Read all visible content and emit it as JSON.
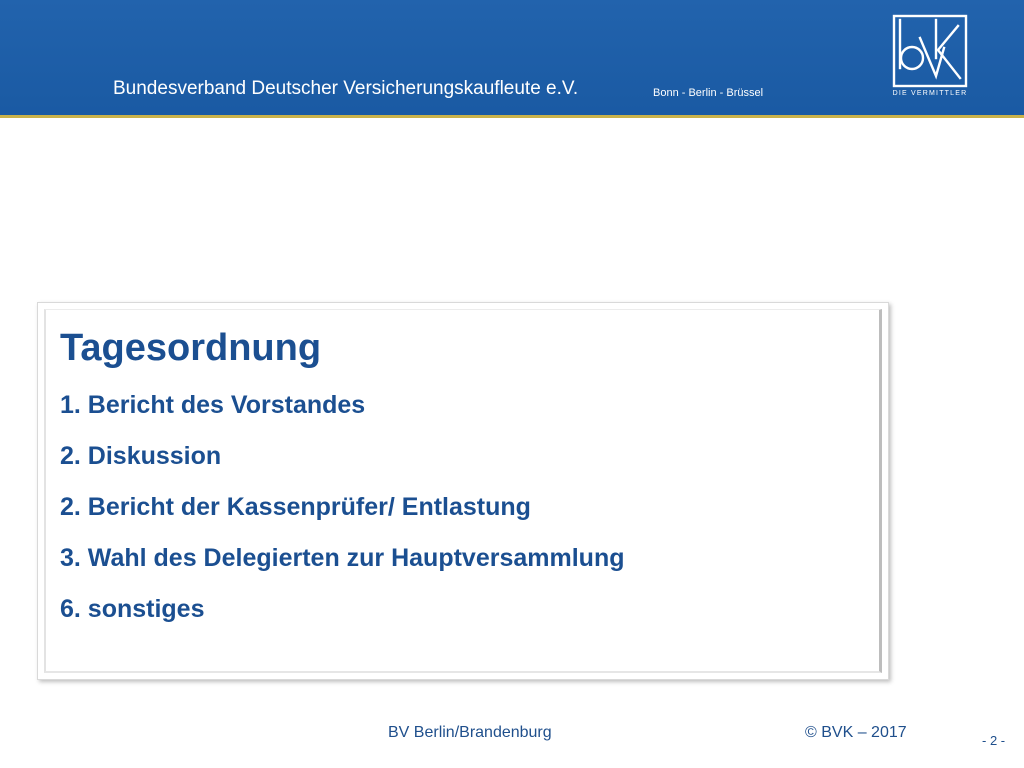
{
  "header": {
    "organization": "Bundesverband Deutscher Versicherungskaufleute e.V.",
    "locations": "Bonn - Berlin - Brüssel",
    "logo": {
      "name": "bvk-logo",
      "letters": "bvk",
      "tagline": "Die Vermittler"
    },
    "colors": {
      "header_blue": "#1f5fa8",
      "accent_line": "#c9b24a"
    }
  },
  "agenda": {
    "title": "Tagesordnung",
    "items": [
      "1. Bericht des Vorstandes",
      "2. Diskussion",
      "2. Bericht der Kassenprüfer/ Entlastung",
      "3. Wahl des Delegierten zur Hauptversammlung",
      "6. sonstiges"
    ],
    "text_color": "#1b4f91"
  },
  "footer": {
    "chapter": "BV Berlin/Brandenburg",
    "copyright": "© BVK – 2017",
    "page_number": "- 2 -"
  }
}
